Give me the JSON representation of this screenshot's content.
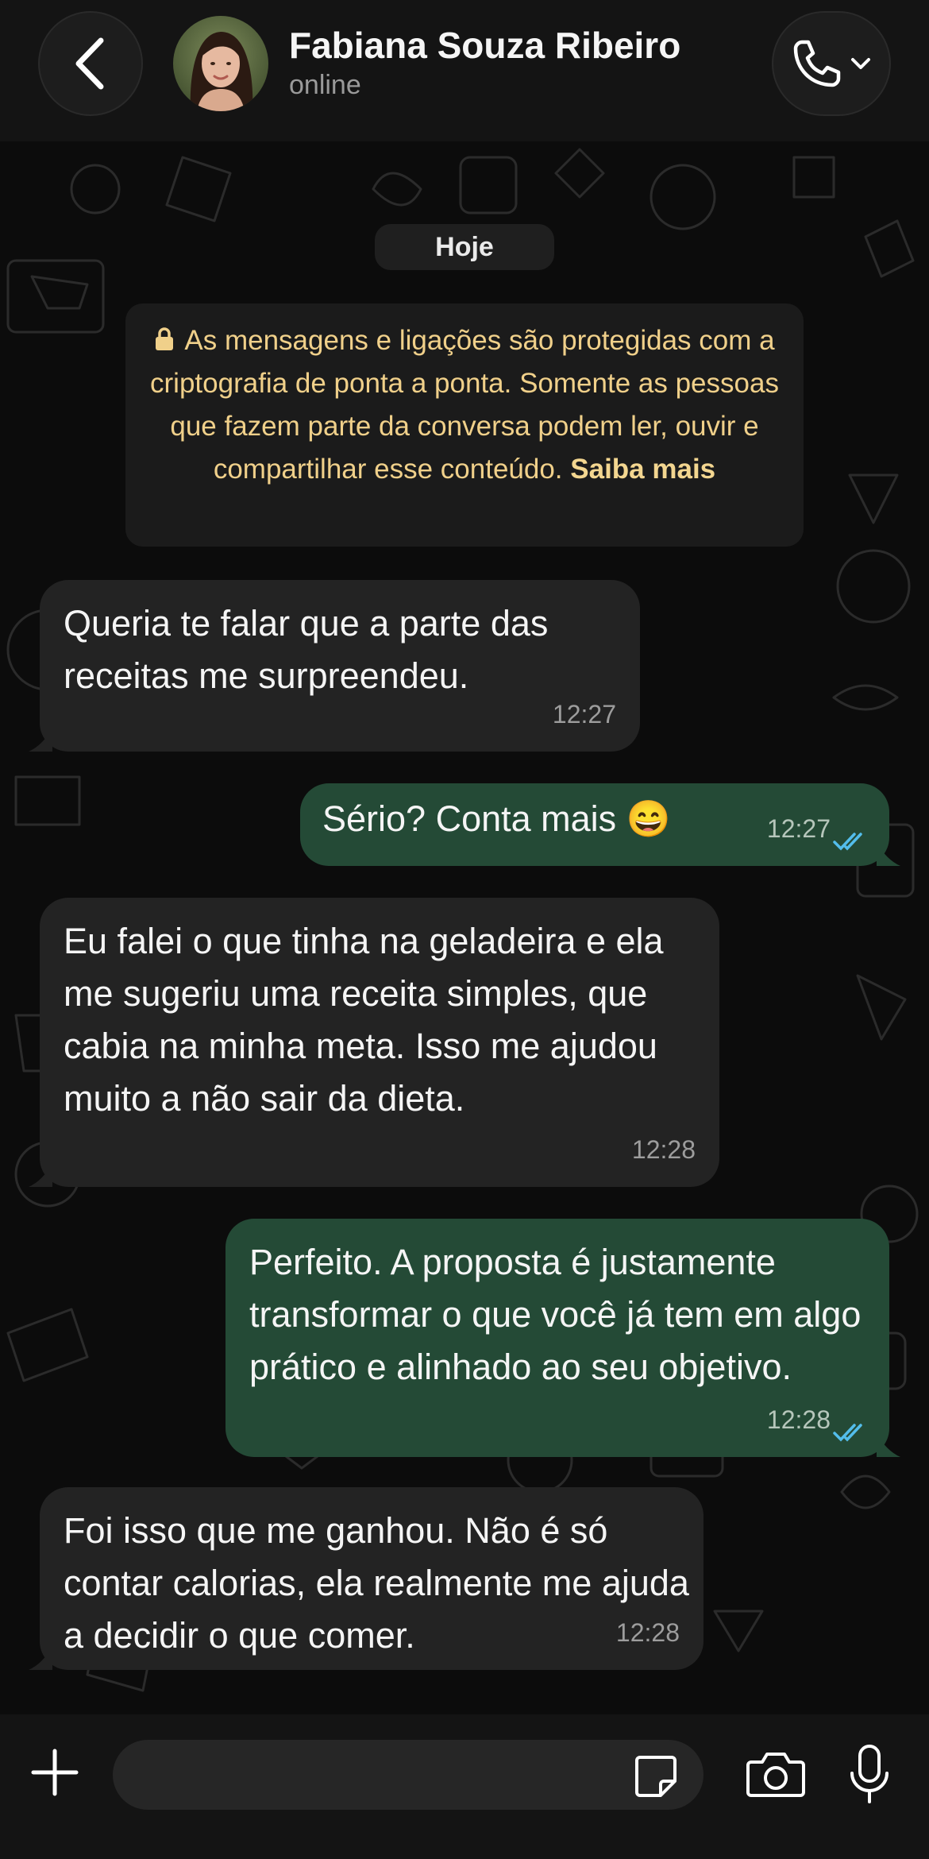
{
  "header": {
    "back_icon": "chevron-left-icon",
    "contact_name": "Fabiana Souza Ribeiro",
    "status": "online",
    "call_icon": "phone-icon"
  },
  "chat": {
    "date_separator": "Hoje",
    "encryption_notice": {
      "text": "As mensagens e ligações são protegidas com a criptografia de ponta a ponta. Somente as pessoas que fazem parte da conversa podem ler, ouvir e compartilhar esse conteúdo.",
      "link": "Saiba mais"
    },
    "messages": [
      {
        "direction": "in",
        "text": "Queria te falar que a parte das receitas me surpreendeu.",
        "time": "12:27"
      },
      {
        "direction": "out",
        "text": "Sério? Conta mais 😄",
        "time": "12:27",
        "status": "read"
      },
      {
        "direction": "in",
        "text": "Eu falei o que tinha na geladeira e ela me sugeriu uma receita simples, que cabia na minha meta. Isso me ajudou muito a não sair da dieta.",
        "time": "12:28"
      },
      {
        "direction": "out",
        "text": "Perfeito. A proposta é justamente transformar o que você já tem em algo prático e alinhado ao seu objetivo.",
        "time": "12:28",
        "status": "read"
      },
      {
        "direction": "in",
        "text": "Foi isso que me ganhou. Não é só contar calorias, ela realmente me ajuda a decidir o que comer.",
        "time": "12:28"
      }
    ]
  },
  "composer": {
    "input_value": "",
    "icons": [
      "plus-icon",
      "sticker-icon",
      "camera-icon",
      "microphone-icon"
    ]
  },
  "colors": {
    "incoming_bubble": "#232323",
    "outgoing_bubble": "#244a36",
    "read_ticks": "#53bdeb",
    "notice_text": "#f0d08a"
  }
}
